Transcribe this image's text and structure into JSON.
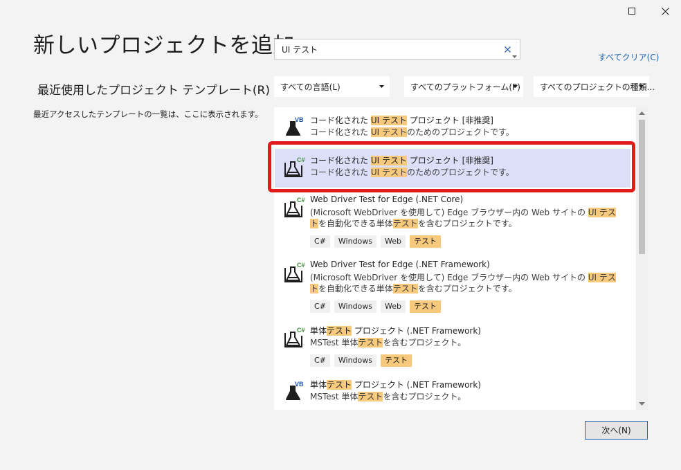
{
  "window": {
    "maximize_icon": "maximize-icon",
    "close_icon": "close-icon"
  },
  "title": "新しいプロジェクトを追加",
  "recent": {
    "heading": "最近使用したプロジェクト テンプレート(R)",
    "message": "最近アクセスしたテンプレートの一覧は、ここに表示されます。"
  },
  "search": {
    "value": "UI テスト",
    "clear_icon": "clear-x-icon",
    "dropdown_icon": "dropdown-arrow-icon"
  },
  "clear_all": "すべてクリア(C)",
  "filters": [
    {
      "label": "すべての言語(L)"
    },
    {
      "label": "すべてのプラットフォーム(P)"
    },
    {
      "label": "すべてのプロジェクトの種類..."
    }
  ],
  "colors": {
    "highlight": "#f6c97d",
    "selected_bg": "#dcdff7",
    "red_frame": "#e11a1a",
    "accent_blue": "#1a64b5"
  },
  "templates": [
    {
      "lang": "VB",
      "icon": "vb-coded-ui-test-icon",
      "title": [
        "コード化された ",
        "UI テスト",
        " プロジェクト [非推奨]"
      ],
      "desc": [
        "コード化された ",
        "UI テスト",
        "のためのプロジェクトです。"
      ],
      "tags": []
    },
    {
      "lang": "C#",
      "icon": "csharp-coded-ui-test-icon",
      "selected": true,
      "title": [
        "コード化された ",
        "UI テスト",
        " プロジェクト [非推奨]"
      ],
      "desc": [
        "コード化された ",
        "UI テスト",
        "のためのプロジェクトです。"
      ],
      "tags": []
    },
    {
      "lang": "C#",
      "icon": "csharp-test-flask-icon",
      "title": [
        "Web Driver Test for Edge (.NET Core)"
      ],
      "desc": [
        "(Microsoft WebDriver を使用して) Edge ブラウザー内の Web サイトの ",
        "UI テスト",
        "を自動化できる単体",
        "テスト",
        "を含むプロジェクトです。"
      ],
      "tags": [
        "C#",
        "Windows",
        "Web",
        "テスト"
      ]
    },
    {
      "lang": "C#",
      "icon": "csharp-test-flask-icon",
      "title": [
        "Web Driver Test for Edge (.NET Framework)"
      ],
      "desc": [
        "(Microsoft WebDriver を使用して) Edge ブラウザー内の Web サイトの ",
        "UI テスト",
        "を自動化できる単体",
        "テスト",
        "を含むプロジェクトです。"
      ],
      "tags": [
        "C#",
        "Windows",
        "Web",
        "テスト"
      ]
    },
    {
      "lang": "C#",
      "icon": "csharp-test-flask-icon",
      "title": [
        "単体",
        "テスト",
        " プロジェクト (.NET Framework)"
      ],
      "desc": [
        "MSTest 単体",
        "テスト",
        "を含むプロジェクト。"
      ],
      "tags": [
        "C#",
        "Windows",
        "テスト"
      ]
    },
    {
      "lang": "VB",
      "icon": "vb-test-flask-icon",
      "title": [
        "単体",
        "テスト",
        " プロジェクト (.NET Framework)"
      ],
      "desc": [
        "MSTest 単体",
        "テスト",
        "を含むプロジェクト。"
      ],
      "tags": []
    }
  ],
  "highlight_tag": "テスト",
  "next_button": "次へ(N)"
}
